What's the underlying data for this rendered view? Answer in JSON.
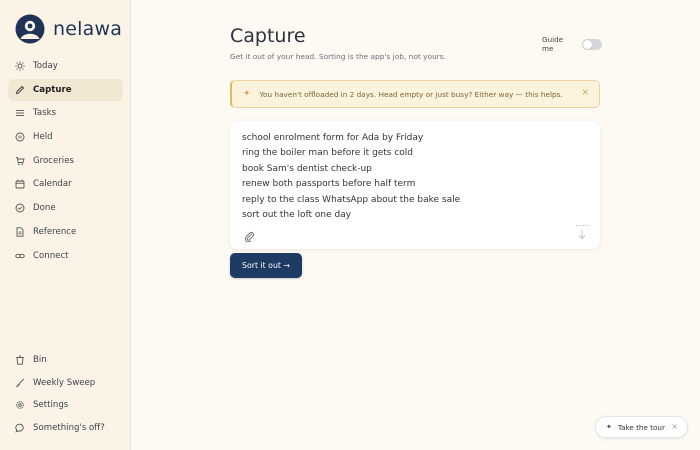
{
  "brand": {
    "name": "nelawa"
  },
  "nav": {
    "primary": [
      {
        "label": "Today",
        "icon": "sun-icon",
        "active": false
      },
      {
        "label": "Capture",
        "icon": "pencil-icon",
        "active": true
      },
      {
        "label": "Tasks",
        "icon": "list-icon",
        "active": false
      },
      {
        "label": "Held",
        "icon": "pause-circle-icon",
        "active": false
      },
      {
        "label": "Groceries",
        "icon": "cart-icon",
        "active": false
      },
      {
        "label": "Calendar",
        "icon": "calendar-icon",
        "active": false
      },
      {
        "label": "Done",
        "icon": "check-circle-icon",
        "active": false
      },
      {
        "label": "Reference",
        "icon": "document-icon",
        "active": false
      },
      {
        "label": "Connect",
        "icon": "link-icon",
        "active": false
      }
    ],
    "secondary": [
      {
        "label": "Bin",
        "icon": "trash-icon"
      },
      {
        "label": "Weekly Sweep",
        "icon": "broom-icon"
      },
      {
        "label": "Settings",
        "icon": "gear-icon"
      },
      {
        "label": "Something's off?",
        "icon": "chat-bubble-icon"
      }
    ]
  },
  "page": {
    "title": "Capture",
    "subtitle": "Get it out of your head. Sorting is the app's job, not yours.",
    "guide_label": "Guide me",
    "guide_enabled": false
  },
  "banner": {
    "text": "You haven't offloaded in 2 days. Head empty or just busy? Either way — this helps.",
    "icon": "sparkle-icon",
    "close": "×"
  },
  "capture": {
    "lines": [
      "school enrolment form for Ada by Friday",
      "ring the boiler man before it gets cold",
      "book Sam's dentist check-up",
      "renew both passports before half term",
      "reply to the class WhatsApp about the bake sale",
      "sort out the loft one day"
    ]
  },
  "actions": {
    "sort_label": "Sort it out →"
  },
  "tour": {
    "label": "Take the tour",
    "icon": "sparkle-icon",
    "close": "×"
  },
  "colors": {
    "sidebar_bg": "#fbf4e6",
    "active_bg": "#f2e7d2",
    "brand": "#1e3356",
    "primary_button": "#1d3b63",
    "banner_bg": "#fcf3df",
    "banner_accent": "#e4b95a"
  }
}
